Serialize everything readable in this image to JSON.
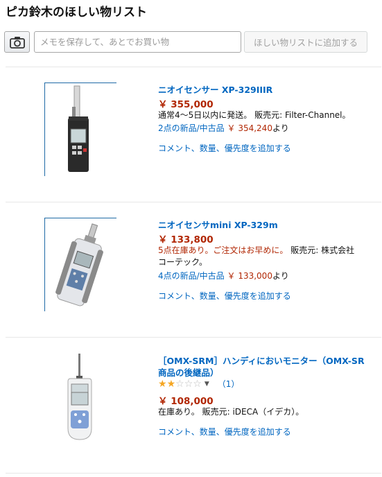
{
  "page": {
    "title": "ピカ鈴木のほしい物リスト",
    "memo_placeholder": "メモを保存して、あとでお買い物",
    "add_button": "ほしい物リストに追加する"
  },
  "icons": {
    "camera": "camera-icon"
  },
  "colors": {
    "link": "#0066c0",
    "price": "#b12704",
    "star": "#f5a623"
  },
  "items": [
    {
      "name": "ニオイセンサー XP-329IIIR",
      "price": "￥ 355,000",
      "availability": "通常4～5日以内に発送。",
      "seller_label": "販売元: Filter-Channel。",
      "offers_label": "2点の新品/中古品",
      "offers_price": "￥ 354,240",
      "offers_suffix": "より",
      "actions": "コメント、数量、優先度を追加する"
    },
    {
      "name": "ニオイセンサmini XP-329m",
      "price": "￥ 133,800",
      "availability": "5点在庫あり。ご注文はお早めに。",
      "seller_label": "販売元: 株式会社",
      "seller_label2": "コーテック。",
      "offers_label": "4点の新品/中古品",
      "offers_price": "￥ 133,000",
      "offers_suffix": "より",
      "actions": "コメント、数量、優先度を追加する"
    },
    {
      "name_line1": "［OMX-SRM］ハンディにおいモニター（OMX-SR",
      "name_line2": "商品の後継品）",
      "rating": 2,
      "rating_max": 5,
      "review_count": "（1）",
      "price": "￥ 108,000",
      "availability": "在庫あり。",
      "seller_label": "販売元: iDECA（イデカ）。",
      "actions": "コメント、数量、優先度を追加する"
    }
  ]
}
